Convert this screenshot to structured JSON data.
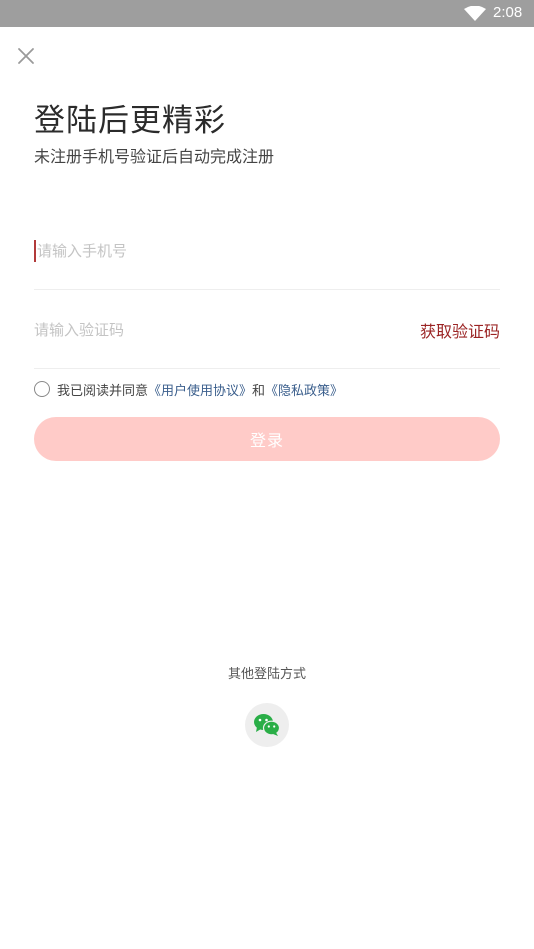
{
  "status_bar": {
    "time": "2:08",
    "icons": [
      "wifi-icon"
    ]
  },
  "header": {
    "close_icon": "close-icon"
  },
  "main": {
    "title": "登陆后更精彩",
    "subtitle": "未注册手机号验证后自动完成注册",
    "phone_field": {
      "placeholder": "请输入手机号",
      "value": ""
    },
    "code_field": {
      "placeholder": "请输入验证码",
      "value": ""
    },
    "get_code_label": "获取验证码",
    "agreement": {
      "prefix": "我已阅读并同意",
      "user_agreement": "《用户使用协议》",
      "conjunction": "和",
      "privacy_policy": "《隐私政策》",
      "checked": false
    },
    "login_label": "登录"
  },
  "other_login": {
    "label": "其他登陆方式",
    "methods": [
      {
        "icon": "wechat-icon"
      }
    ]
  },
  "colors": {
    "accent": "#9b2424",
    "login_button_disabled": "#ffcbc8",
    "link": "#3a5e8c",
    "wechat": "#2aae47",
    "status_bar": "#9e9e9e"
  }
}
